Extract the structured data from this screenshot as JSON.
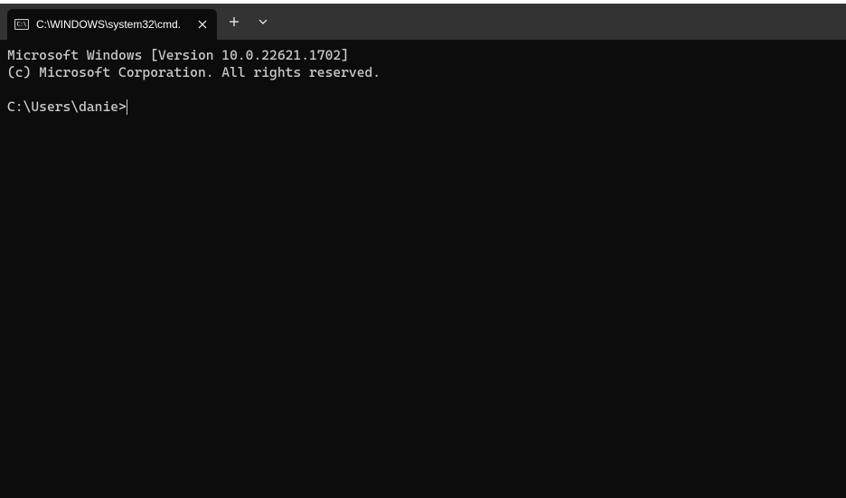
{
  "tab": {
    "title": "C:\\WINDOWS\\system32\\cmd."
  },
  "terminal": {
    "banner_line1": "Microsoft Windows [Version 10.0.22621.1702]",
    "banner_line2": "(c) Microsoft Corporation. All rights reserved.",
    "prompt": "C:\\Users\\danie>"
  }
}
